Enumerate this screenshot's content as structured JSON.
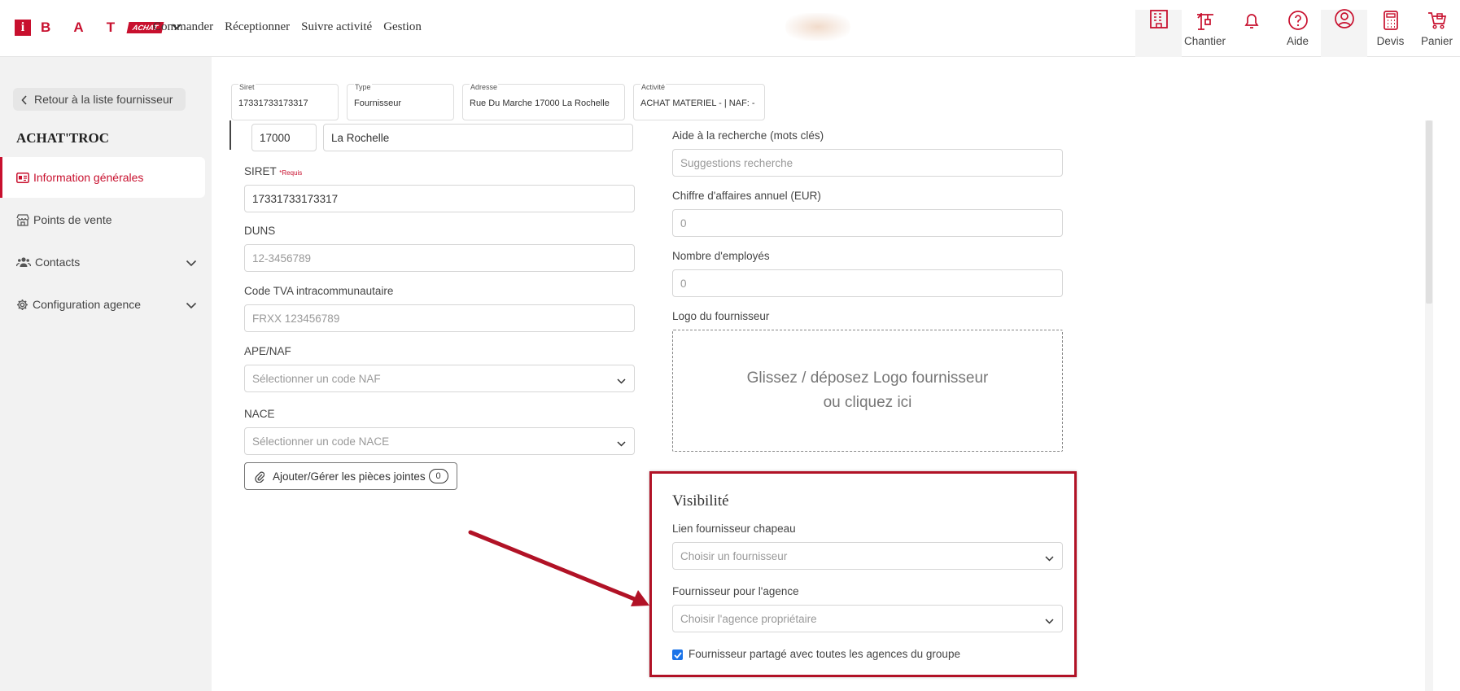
{
  "header": {
    "logo_letters": "B A T",
    "logo_i": "i",
    "logo_badge": "ACHAT",
    "nav": [
      "Commander",
      "Réceptionner",
      "Suivre activité",
      "Gestion"
    ],
    "icons": [
      {
        "name": "building-icon",
        "label": ""
      },
      {
        "name": "crane-icon",
        "label": "Chantier"
      },
      {
        "name": "bell-icon",
        "label": ""
      },
      {
        "name": "help-icon",
        "label": "Aide"
      },
      {
        "name": "user-icon",
        "label": ""
      },
      {
        "name": "calculator-icon",
        "label": "Devis"
      },
      {
        "name": "cart-icon",
        "label": "Panier"
      }
    ]
  },
  "sidebar": {
    "back_label": "Retour à la liste fournisseur",
    "company_name": "ACHAT'TROC",
    "items": [
      {
        "label": "Information générales",
        "icon": "id-card-icon",
        "active": true
      },
      {
        "label": "Points de vente",
        "icon": "store-icon"
      },
      {
        "label": "Contacts",
        "icon": "users-icon",
        "expandable": true
      },
      {
        "label": "Configuration agence",
        "icon": "gear-icon",
        "expandable": true
      }
    ]
  },
  "info_cards": [
    {
      "key": "Siret",
      "value": "17331733173317"
    },
    {
      "key": "Type",
      "value": "Fournisseur"
    },
    {
      "key": "Adresse",
      "value": "Rue Du Marche 17000 La Rochelle"
    },
    {
      "key": "Activité",
      "value": "ACHAT MATERIEL - | NAF: -"
    }
  ],
  "form": {
    "postal_code": "17000",
    "city": "La Rochelle",
    "siret_label": "SIRET",
    "siret_required": "*Requis",
    "siret_value": "17331733173317",
    "duns_label": "DUNS",
    "duns_placeholder": "12-3456789",
    "tva_label": "Code TVA intracommunautaire",
    "tva_placeholder": "FRXX 123456789",
    "ape_label": "APE/NAF",
    "ape_placeholder": "Sélectionner un code NAF",
    "nace_label": "NACE",
    "nace_placeholder": "Sélectionner un code NACE",
    "attach_label": "Ajouter/Gérer les pièces jointes",
    "attach_count": "0",
    "keywords_label": "Aide à la recherche (mots clés)",
    "keywords_placeholder": "Suggestions recherche",
    "revenue_label": "Chiffre d'affaires annuel (EUR)",
    "revenue_value": "0",
    "employees_label": "Nombre d'employés",
    "employees_value": "0",
    "logo_label": "Logo du fournisseur",
    "dropzone_line1": "Glissez / déposez Logo fournisseur",
    "dropzone_line2": "ou cliquez ici"
  },
  "visibility": {
    "title": "Visibilité",
    "parent_label": "Lien fournisseur chapeau",
    "parent_placeholder": "Choisir un fournisseur",
    "agency_label": "Fournisseur pour l'agence",
    "agency_placeholder": "Choisir l'agence propriétaire",
    "shared_label": "Fournisseur partagé avec toutes les agences du groupe",
    "shared_checked": true
  },
  "colors": {
    "brand": "#c8102e",
    "highlight_box": "#b11226",
    "arrow": "#b11226",
    "checkbox": "#1a73e8"
  }
}
